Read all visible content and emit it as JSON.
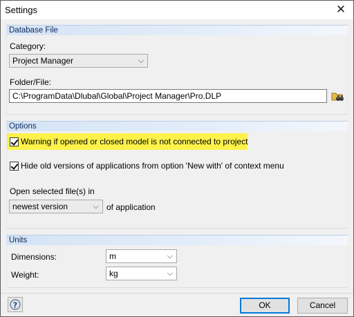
{
  "window": {
    "title": "Settings",
    "close_glyph": "✕"
  },
  "database": {
    "header": "Database File",
    "category_label": "Category:",
    "category_value": "Project Manager",
    "folder_label": "Folder/File:",
    "folder_value": "C:\\ProgramData\\Dlubal\\Global\\Project Manager\\Pro.DLP",
    "browse_icon": "folder-binoculars-icon"
  },
  "options": {
    "header": "Options",
    "warning_label": "Warning if opened or closed model is not connected to project",
    "warning_checked": true,
    "hide_label": "Hide old versions of applications from option 'New with' of context menu",
    "hide_checked": true,
    "open_label": "Open selected file(s) in",
    "open_value": "newest version",
    "open_suffix": "of application",
    "highlight_color": "#fdf24a"
  },
  "units": {
    "header": "Units",
    "dimensions_label": "Dimensions:",
    "dimensions_value": "m",
    "weight_label": "Weight:",
    "weight_value": "kg"
  },
  "footer": {
    "help_icon": "help-icon",
    "ok_label": "OK",
    "cancel_label": "Cancel"
  }
}
